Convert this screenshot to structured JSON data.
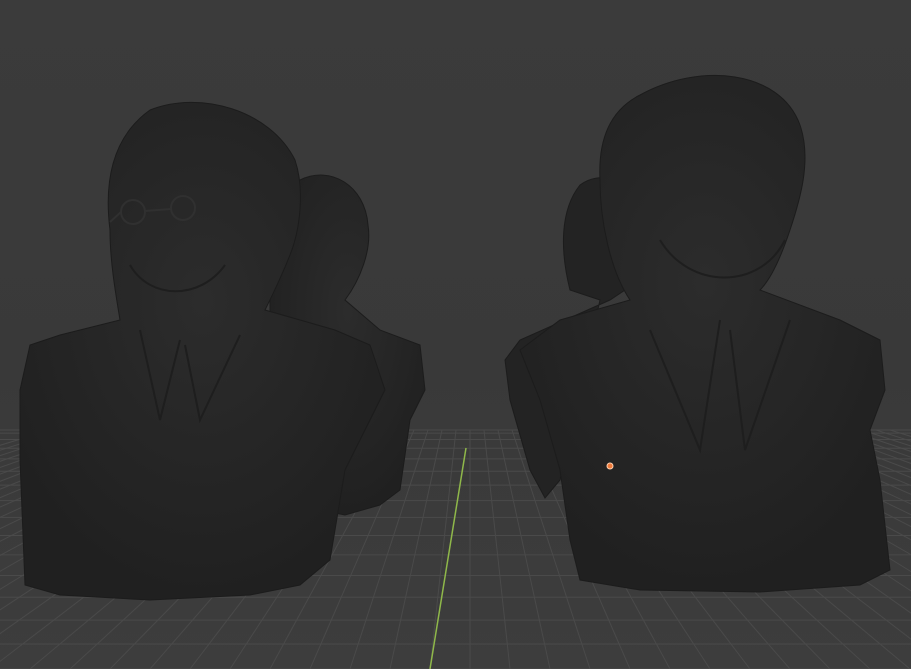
{
  "viewport": {
    "background_color": "#3a3a3a",
    "grid_line_color": "#4a4a4a",
    "y_axis_color": "#8fb84a",
    "mesh_color": "#262626",
    "mesh_shadow_color": "#1c1c1c",
    "origin_marker_color": "#f07a3a"
  },
  "scene": {
    "objects": [
      {
        "name": "bust-with-glasses",
        "kind": "mesh"
      },
      {
        "name": "bust-behind-left",
        "kind": "mesh"
      },
      {
        "name": "bust-right",
        "kind": "mesh"
      },
      {
        "name": "bust-behind-right",
        "kind": "mesh"
      }
    ],
    "origin_marker": "origin-point-icon",
    "y_axis": "y-axis-line"
  }
}
